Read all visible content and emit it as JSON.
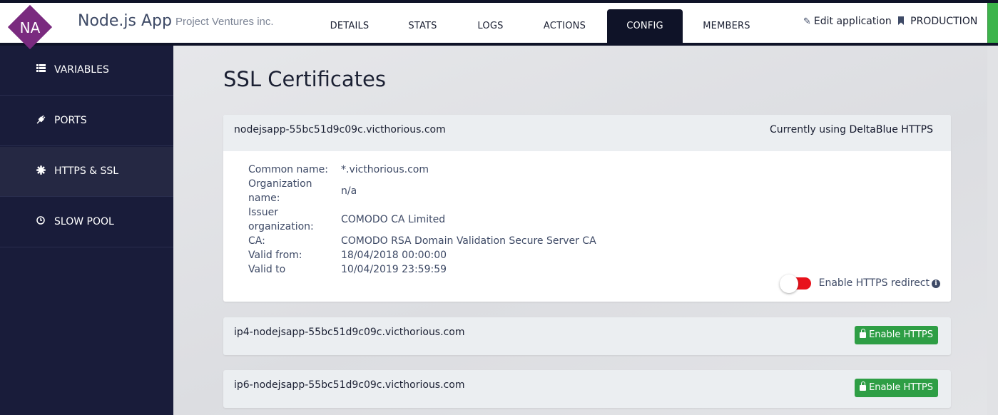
{
  "app": {
    "logo_initials": "NA",
    "title": "Node.js App",
    "subtitle": "Project Ventures inc."
  },
  "tabs": [
    {
      "label": "DETAILS",
      "active": false
    },
    {
      "label": "STATS",
      "active": false
    },
    {
      "label": "LOGS",
      "active": false
    },
    {
      "label": "ACTIONS",
      "active": false
    },
    {
      "label": "CONFIG",
      "active": true
    },
    {
      "label": "MEMBERS",
      "active": false
    }
  ],
  "header_actions": {
    "edit_label": "Edit application",
    "edit_icon": "pencil-icon",
    "env_label": "PRODUCTION",
    "env_icon": "bookmark-icon"
  },
  "sidebar": {
    "items": [
      {
        "label": "VARIABLES",
        "icon": "list-icon",
        "active": false
      },
      {
        "label": "PORTS",
        "icon": "plug-icon",
        "active": false
      },
      {
        "label": "HTTPS & SSL",
        "icon": "certificate-icon",
        "active": true
      },
      {
        "label": "SLOW POOL",
        "icon": "clock-icon",
        "active": false
      }
    ]
  },
  "page": {
    "title": "SSL Certificates"
  },
  "certificates": [
    {
      "domain": "nodejsapp-55bc51d9c09c.victhorious.com",
      "status_prefix": "Currently using ",
      "status_provider": "DeltaBlue HTTPS",
      "details": [
        {
          "label": "Common name:",
          "value": "*.victhorious.com"
        },
        {
          "label": "Organization name:",
          "value": "n/a"
        },
        {
          "label": "Issuer organization:",
          "value": "COMODO CA Limited"
        },
        {
          "label": "CA:",
          "value": "COMODO RSA Domain Validation Secure Server CA"
        },
        {
          "label": "Valid from:",
          "value": "18/04/2018 00:00:00"
        },
        {
          "label": "Valid to",
          "value": "10/04/2019 23:59:59"
        }
      ],
      "redirect_label": "Enable HTTPS redirect",
      "redirect_enabled": false
    },
    {
      "domain": "ip4-nodejsapp-55bc51d9c09c.victhorious.com",
      "button_label": "Enable HTTPS"
    },
    {
      "domain": "ip6-nodejsapp-55bc51d9c09c.victhorious.com",
      "button_label": "Enable HTTPS"
    }
  ],
  "colors": {
    "nav_dark": "#0f1328",
    "sidebar": "#191c3a",
    "logo": "#7a2a7f",
    "toggle_off": "#e8121b",
    "enable_button": "#2e9e45",
    "production_edge": "#3cb44b"
  }
}
